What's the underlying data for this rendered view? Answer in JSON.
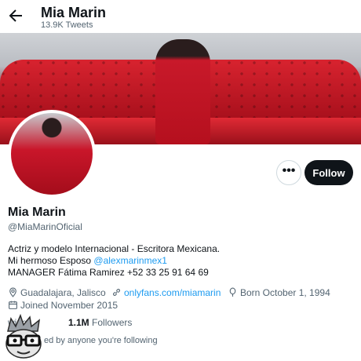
{
  "header": {
    "back_icon": "arrow-left-icon",
    "title": "Mia Marin",
    "tweet_count": "13.9K Tweets"
  },
  "profile": {
    "name": "Mia Marin",
    "handle": "@MiaMarinOficial",
    "bio": {
      "line1": "Actriz y modelo Internacional - Escritora Mexicana.",
      "line2_prefix": "Mi hermoso Esposo ",
      "line2_link": "@alexmarinmex1",
      "line3": "MANAGER Fátima Ramirez +52 33 25 91 64 69"
    },
    "location": "Guadalajara, Jalisco",
    "website": "onlyfans.com/miamarin",
    "born": "Born October 1, 1994",
    "joined": "Joined November 2015"
  },
  "actions": {
    "more_label": "•••",
    "follow_label": "Follow"
  },
  "stats": {
    "following_value": "",
    "following_label": "wing",
    "followers_value": "1.1M",
    "followers_label": "Followers"
  },
  "followed_by": "ed by anyone you're following",
  "colors": {
    "accent": "#1d9bf0",
    "text": "#0f1419",
    "secondary": "#536471",
    "follow_bg": "#0f1419"
  }
}
